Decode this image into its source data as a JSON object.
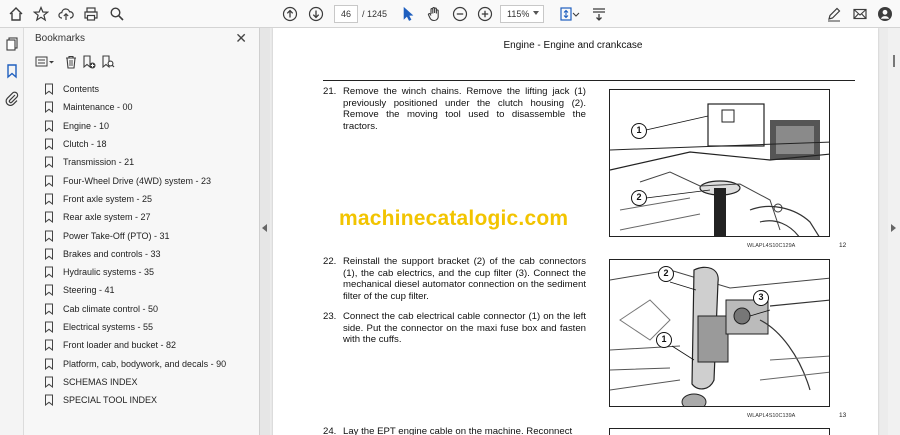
{
  "toolbar": {
    "page_current": "46",
    "page_total": "/ 1245",
    "zoom": "115%"
  },
  "bookmarks_panel": {
    "title": "Bookmarks",
    "items": [
      {
        "label": "Contents"
      },
      {
        "label": "Maintenance - 00"
      },
      {
        "label": "Engine - 10"
      },
      {
        "label": "Clutch - 18"
      },
      {
        "label": "Transmission - 21"
      },
      {
        "label": "Four-Wheel Drive (4WD) system - 23"
      },
      {
        "label": "Front axle system - 25"
      },
      {
        "label": "Rear axle system - 27"
      },
      {
        "label": "Power Take-Off (PTO) - 31"
      },
      {
        "label": "Brakes and controls - 33"
      },
      {
        "label": "Hydraulic systems - 35"
      },
      {
        "label": "Steering - 41"
      },
      {
        "label": "Cab climate control - 50"
      },
      {
        "label": "Electrical systems - 55"
      },
      {
        "label": "Front loader and bucket - 82"
      },
      {
        "label": "Platform, cab, bodywork, and decals - 90"
      },
      {
        "label": "SCHEMAS INDEX"
      },
      {
        "label": "SPECIAL TOOL INDEX"
      }
    ]
  },
  "document": {
    "header": "Engine - Engine and crankcase",
    "watermark": "machinecatalogic.com",
    "steps": [
      {
        "num": "21.",
        "text": "Remove the winch chains.  Remove the lifting jack (1) previously positioned under the clutch housing (2). Remove the moving tool used to disassemble the tractors."
      },
      {
        "num": "22.",
        "text": "Reinstall the support bracket (2) of the cab connectors (1), the cab electrics, and the cup filter (3).  Connect the mechanical diesel automator connection on the sediment filter of the cup filter."
      },
      {
        "num": "23.",
        "text": "Connect the cab electrical cable connector (1) on the left side.  Put the connector on the maxi fuse box and fasten with the cuffs."
      },
      {
        "num": "24.",
        "text": "Lay the EPT engine cable on the machine.  Reconnect"
      }
    ],
    "figures": [
      {
        "caption": "WLAPL4S10C129A",
        "number": "12",
        "callouts": [
          "1",
          "2"
        ]
      },
      {
        "caption": "WLAPL4S10C139A",
        "number": "13",
        "callouts": [
          "2",
          "3",
          "1"
        ]
      }
    ]
  }
}
